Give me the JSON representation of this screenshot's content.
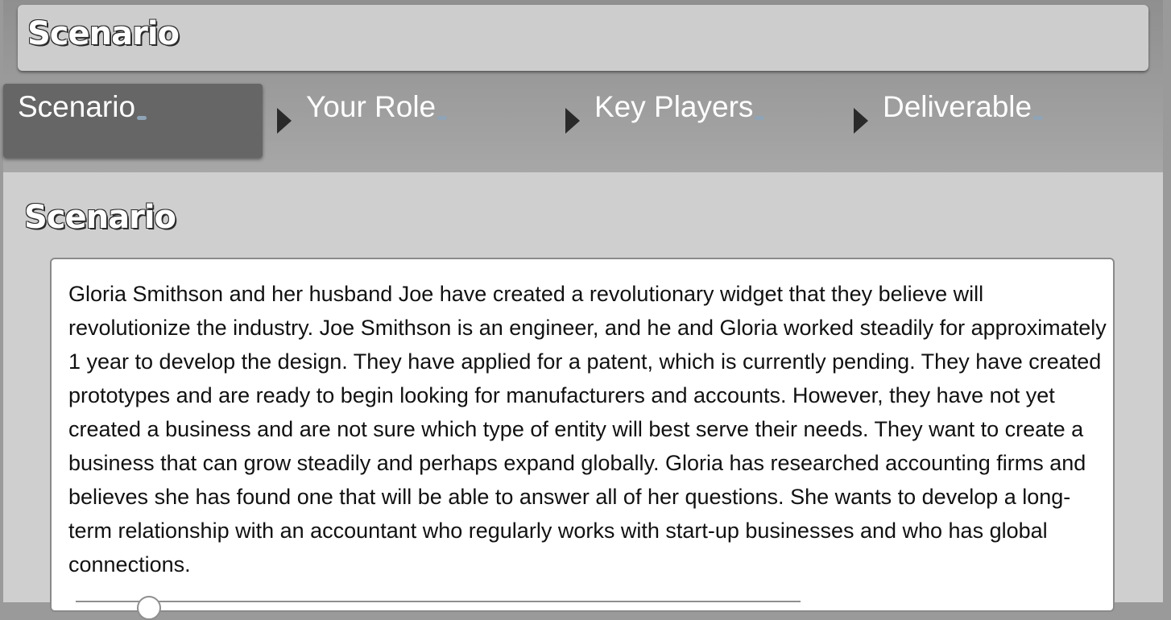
{
  "header": {
    "title": "Scenario"
  },
  "tabs": [
    {
      "label": "Scenario",
      "active": true
    },
    {
      "label": "Your Role",
      "active": false
    },
    {
      "label": "Key Players",
      "active": false
    },
    {
      "label": "Deliverable",
      "active": false
    }
  ],
  "section": {
    "heading": "Scenario",
    "body": "Gloria Smithson and her husband Joe have created a revolutionary widget that they believe will revolutionize the industry. Joe Smithson is an engineer, and he and Gloria worked steadily for approximately 1 year to develop the design. They have applied for a patent, which is currently pending. They have created prototypes and are ready to begin looking for manufacturers and accounts. However, they have not yet created a business and are not sure which type of entity will best serve their needs. They want to create a business that can grow steadily and perhaps expand globally. Gloria has researched accounting firms and believes she has found one that will be able to answer all of her questions. She wants to develop a long-term relationship with an accountant who regularly works with start-up businesses and who has global connections."
  },
  "icons": {
    "tab_arrow": "triangle-right-icon"
  },
  "colors": {
    "active_tab": "#666666",
    "title_bar": "#cdcdcd",
    "content_bg": "#ffffff"
  }
}
